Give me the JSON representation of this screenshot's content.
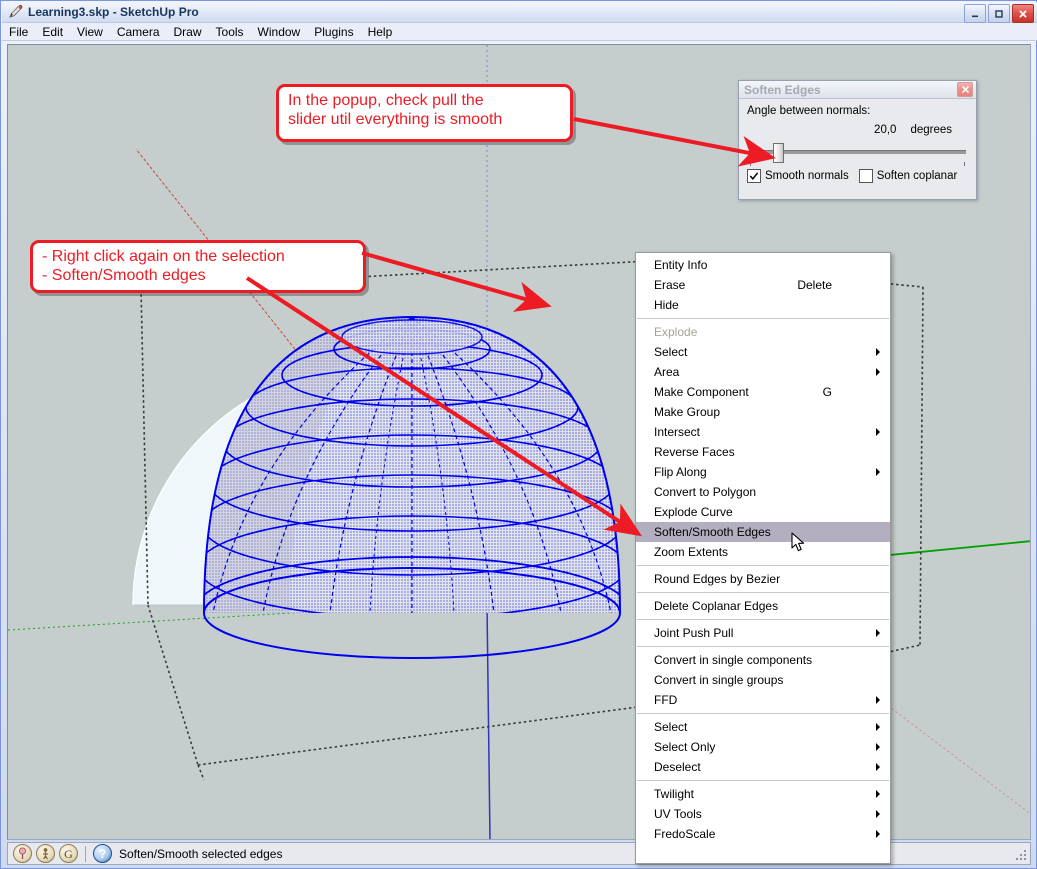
{
  "window": {
    "title_file": "Learning3.skp",
    "title_sep": " - ",
    "title_app": "SketchUp Pro",
    "title_full": "Learning3.skp - SketchUp Pro",
    "app_icon": "pencil-icon",
    "minimize_label": "–",
    "maximize_label": "□",
    "close_label": "✕"
  },
  "menubar": {
    "items": [
      {
        "label": "File"
      },
      {
        "label": "Edit"
      },
      {
        "label": "View"
      },
      {
        "label": "Camera"
      },
      {
        "label": "Draw"
      },
      {
        "label": "Tools"
      },
      {
        "label": "Window"
      },
      {
        "label": "Plugins"
      },
      {
        "label": "Help"
      }
    ]
  },
  "soften_dialog": {
    "title": "Soften Edges",
    "close_label": "✕",
    "angle_label": "Angle between normals:",
    "angle_value": "20,0",
    "angle_units": "degrees",
    "slider_position_pct": 11,
    "smooth_normals": {
      "label": "Smooth normals",
      "checked": true,
      "check_glyph": "✔"
    },
    "soften_coplanar": {
      "label": "Soften coplanar",
      "checked": false,
      "check_glyph": ""
    }
  },
  "context_menu": {
    "groups": [
      {
        "items": [
          {
            "label": "Entity Info",
            "shortcut": "",
            "submenu": false,
            "disabled": false,
            "selected": false
          },
          {
            "label": "Erase",
            "shortcut": "Delete",
            "submenu": false,
            "disabled": false,
            "selected": false
          },
          {
            "label": "Hide",
            "shortcut": "",
            "submenu": false,
            "disabled": false,
            "selected": false
          }
        ]
      },
      {
        "items": [
          {
            "label": "Explode",
            "shortcut": "",
            "submenu": false,
            "disabled": true,
            "selected": false
          },
          {
            "label": "Select",
            "shortcut": "",
            "submenu": true,
            "disabled": false,
            "selected": false
          },
          {
            "label": "Area",
            "shortcut": "",
            "submenu": true,
            "disabled": false,
            "selected": false
          },
          {
            "label": "Make Component",
            "shortcut": "G",
            "submenu": false,
            "disabled": false,
            "selected": false
          },
          {
            "label": "Make Group",
            "shortcut": "",
            "submenu": false,
            "disabled": false,
            "selected": false
          },
          {
            "label": "Intersect",
            "shortcut": "",
            "submenu": true,
            "disabled": false,
            "selected": false
          },
          {
            "label": "Reverse Faces",
            "shortcut": "",
            "submenu": false,
            "disabled": false,
            "selected": false
          },
          {
            "label": "Flip Along",
            "shortcut": "",
            "submenu": true,
            "disabled": false,
            "selected": false
          },
          {
            "label": "Convert to Polygon",
            "shortcut": "",
            "submenu": false,
            "disabled": false,
            "selected": false
          },
          {
            "label": "Explode Curve",
            "shortcut": "",
            "submenu": false,
            "disabled": false,
            "selected": false
          },
          {
            "label": "Soften/Smooth Edges",
            "shortcut": "",
            "submenu": false,
            "disabled": false,
            "selected": true
          },
          {
            "label": "Zoom Extents",
            "shortcut": "",
            "submenu": false,
            "disabled": false,
            "selected": false
          }
        ]
      },
      {
        "items": [
          {
            "label": "Round Edges by Bezier",
            "shortcut": "",
            "submenu": false,
            "disabled": false,
            "selected": false
          }
        ]
      },
      {
        "items": [
          {
            "label": "Delete Coplanar Edges",
            "shortcut": "",
            "submenu": false,
            "disabled": false,
            "selected": false
          }
        ]
      },
      {
        "items": [
          {
            "label": "Joint Push Pull",
            "shortcut": "",
            "submenu": true,
            "disabled": false,
            "selected": false
          }
        ]
      },
      {
        "items": [
          {
            "label": "Convert in single components",
            "shortcut": "",
            "submenu": false,
            "disabled": false,
            "selected": false
          },
          {
            "label": "Convert in single groups",
            "shortcut": "",
            "submenu": false,
            "disabled": false,
            "selected": false
          },
          {
            "label": "FFD",
            "shortcut": "",
            "submenu": true,
            "disabled": false,
            "selected": false
          }
        ]
      },
      {
        "items": [
          {
            "label": "Select",
            "shortcut": "",
            "submenu": true,
            "disabled": false,
            "selected": false
          },
          {
            "label": "Select Only",
            "shortcut": "",
            "submenu": true,
            "disabled": false,
            "selected": false
          },
          {
            "label": "Deselect",
            "shortcut": "",
            "submenu": true,
            "disabled": false,
            "selected": false
          }
        ]
      },
      {
        "items": [
          {
            "label": "Twilight",
            "shortcut": "",
            "submenu": true,
            "disabled": false,
            "selected": false
          },
          {
            "label": "UV Tools",
            "shortcut": "",
            "submenu": true,
            "disabled": false,
            "selected": false
          },
          {
            "label": "FredoScale",
            "shortcut": "",
            "submenu": true,
            "disabled": false,
            "selected": false
          }
        ]
      }
    ]
  },
  "annotations": [
    {
      "id": "popup-callout",
      "line1": "In the popup, check pull the",
      "line2": "slider util everything is smooth"
    },
    {
      "id": "rightclick-callout",
      "line1": "- Right click again on the selection",
      "line2": "- Soften/Smooth edges"
    }
  ],
  "statusbar": {
    "icons": [
      {
        "name": "geo-pin-icon",
        "glyph": "♀"
      },
      {
        "name": "person-icon",
        "glyph": "᠆"
      },
      {
        "name": "google-g-icon",
        "glyph": "G"
      }
    ],
    "help_glyph": "?",
    "message": "Soften/Smooth selected edges"
  },
  "viewport": {
    "background_color": "#c5cecc",
    "selection_color": "#0000ee",
    "sphere_fill": "#eff7fb",
    "axis_green": "#00a000",
    "axis_red": "#cc0000",
    "axis_blue": "#4444cc"
  },
  "colors": {
    "accent_red": "#ed1c24",
    "menu_highlight": "#b4afc0",
    "title_text": "#17365d"
  }
}
